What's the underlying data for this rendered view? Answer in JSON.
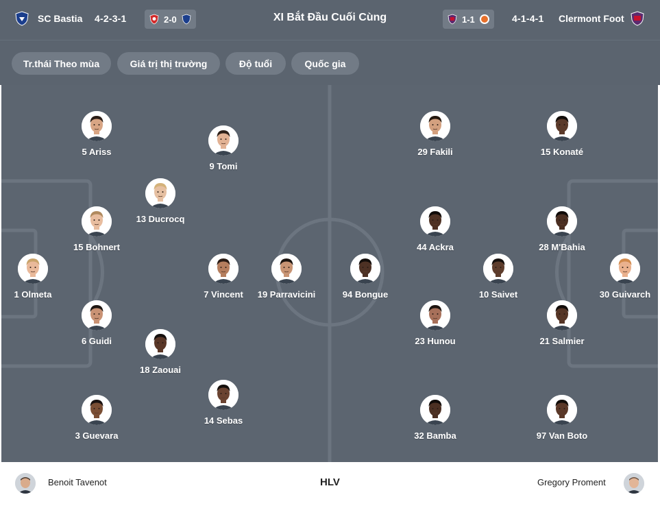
{
  "header": {
    "title": "XI Bắt Đầu Cuối Cùng",
    "home": {
      "name": "SC Bastia",
      "formation": "4-2-3-1",
      "last_result": "2-0",
      "color": "#1b3e8c"
    },
    "away": {
      "name": "Clermont Foot",
      "formation": "4-1-4-1",
      "last_result": "1-1",
      "color": "#c8102e"
    }
  },
  "filters": [
    "Tr.thái Theo mùa",
    "Giá trị thị trường",
    "Độ tuổi",
    "Quốc gia"
  ],
  "home_players": [
    {
      "label": "1 Olmeta",
      "skin": "#e9b99a",
      "hair": "#c9a36a"
    },
    {
      "label": "5 Ariss",
      "skin": "#d8a584",
      "hair": "#2a1d16"
    },
    {
      "label": "15 Bohnert",
      "skin": "#e8bd9f",
      "hair": "#b08a5e"
    },
    {
      "label": "6 Guidi",
      "skin": "#c99274",
      "hair": "#1e1612"
    },
    {
      "label": "3 Guevara",
      "skin": "#7a4e34",
      "hair": "#1a1210"
    },
    {
      "label": "13 Ducrocq",
      "skin": "#e6c0a2",
      "hair": "#d4b27a"
    },
    {
      "label": "18 Zaouai",
      "skin": "#5a3727",
      "hair": "#15100d"
    },
    {
      "label": "9 Tomi",
      "skin": "#e2b294",
      "hair": "#2d2019"
    },
    {
      "label": "7 Vincent",
      "skin": "#b57e5e",
      "hair": "#2a1c15"
    },
    {
      "label": "14 Sebas",
      "skin": "#6a4331",
      "hair": "#15100d"
    },
    {
      "label": "19 Parravicini",
      "skin": "#c89474",
      "hair": "#1d1511"
    }
  ],
  "away_players": [
    {
      "label": "29 Fakili",
      "skin": "#d3a07f",
      "hair": "#24180f"
    },
    {
      "label": "15 Konaté",
      "skin": "#5b3a2a",
      "hair": "#120d0a"
    },
    {
      "label": "44 Ackra",
      "skin": "#4e3123",
      "hair": "#100b09"
    },
    {
      "label": "28 M'Bahia",
      "skin": "#4a2e21",
      "hair": "#100b09"
    },
    {
      "label": "94 Bongue",
      "skin": "#4d3124",
      "hair": "#130e0b"
    },
    {
      "label": "10 Saivet",
      "skin": "#5e3d2c",
      "hair": "#140f0c"
    },
    {
      "label": "30 Guivarch",
      "skin": "#eab18e",
      "hair": "#d28a4c"
    },
    {
      "label": "23 Hunou",
      "skin": "#a7705a",
      "hair": "#1c1410"
    },
    {
      "label": "21 Salmier",
      "skin": "#553526",
      "hair": "#120d0a"
    },
    {
      "label": "32 Bamba",
      "skin": "#4b2f22",
      "hair": "#100b09"
    },
    {
      "label": "97 Van Boto",
      "skin": "#5a3828",
      "hair": "#120d0a"
    }
  ],
  "coaches": {
    "label": "HLV",
    "home": {
      "name": "Benoit Tavenot"
    },
    "away": {
      "name": "Gregory Proment"
    }
  }
}
